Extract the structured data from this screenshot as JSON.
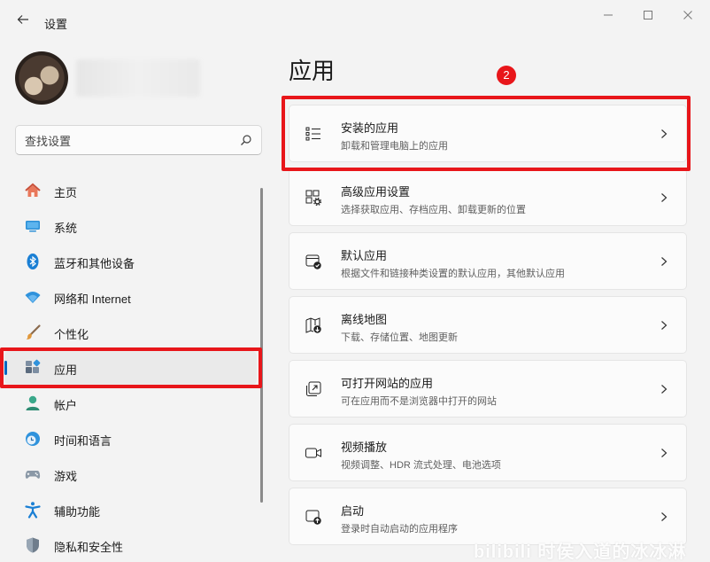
{
  "window": {
    "title": "设置",
    "controls": [
      "minimize-icon",
      "maximize-icon",
      "close-icon"
    ]
  },
  "search": {
    "placeholder": "查找设置"
  },
  "sidebar": {
    "items": [
      {
        "label": "主页",
        "icon": "home-icon"
      },
      {
        "label": "系统",
        "icon": "system-icon"
      },
      {
        "label": "蓝牙和其他设备",
        "icon": "bluetooth-icon"
      },
      {
        "label": "网络和 Internet",
        "icon": "wifi-icon"
      },
      {
        "label": "个性化",
        "icon": "brush-icon"
      },
      {
        "label": "应用",
        "icon": "apps-icon",
        "active": true
      },
      {
        "label": "帐户",
        "icon": "account-icon"
      },
      {
        "label": "时间和语言",
        "icon": "clock-globe-icon"
      },
      {
        "label": "游戏",
        "icon": "gamepad-icon"
      },
      {
        "label": "辅助功能",
        "icon": "accessibility-icon"
      },
      {
        "label": "隐私和安全性",
        "icon": "shield-icon"
      }
    ]
  },
  "main": {
    "title": "应用",
    "cards": [
      {
        "title": "安装的应用",
        "subtitle": "卸载和管理电脑上的应用",
        "icon": "list-icon"
      },
      {
        "title": "高级应用设置",
        "subtitle": "选择获取应用、存档应用、卸载更新的位置",
        "icon": "app-settings-icon"
      },
      {
        "title": "默认应用",
        "subtitle": "根据文件和链接种类设置的默认应用，其他默认应用",
        "icon": "default-app-icon"
      },
      {
        "title": "离线地图",
        "subtitle": "下载、存储位置、地图更新",
        "icon": "offline-map-icon"
      },
      {
        "title": "可打开网站的应用",
        "subtitle": "可在应用而不是浏览器中打开的网站",
        "icon": "open-link-icon"
      },
      {
        "title": "视频播放",
        "subtitle": "视频调整、HDR 流式处理、电池选项",
        "icon": "video-icon"
      },
      {
        "title": "启动",
        "subtitle": "登录时自动启动的应用程序",
        "icon": "startup-icon"
      }
    ]
  },
  "annotation": {
    "step_badge": "2",
    "color": "#e8161a"
  },
  "accent": "#0067c0",
  "watermark": "bilibili 时侯入道的冰冰淋"
}
